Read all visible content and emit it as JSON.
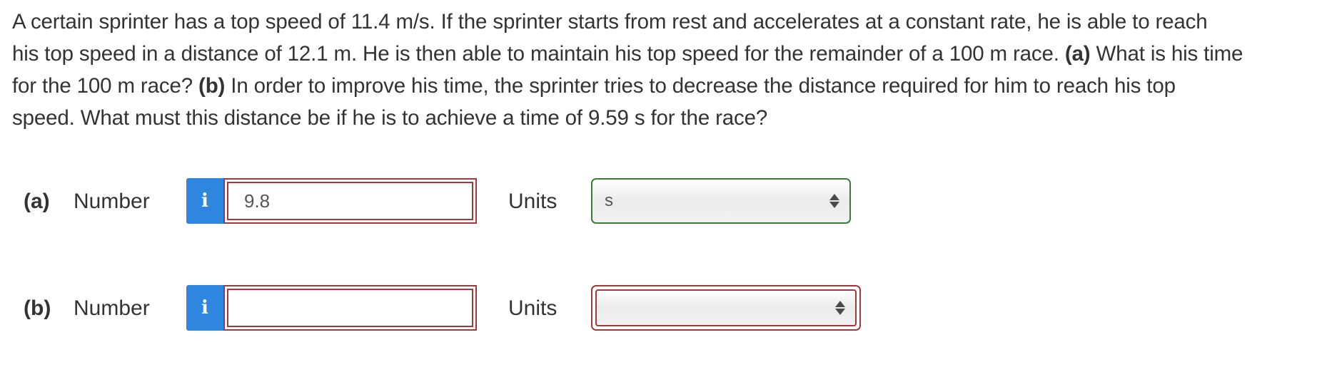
{
  "question": {
    "line1": "A certain sprinter has a top speed of 11.4 m/s. If the sprinter starts from rest and accelerates at a constant rate, he is able to reach",
    "line2_pre": "his top speed in a distance of 12.1 m. He is then able to maintain his top speed for the remainder of a 100 m race.",
    "part_a_tag": "(a)",
    "line2_post": "What is his time",
    "line3_pre": "for the 100 m race?",
    "part_b_tag": "(b)",
    "line3_post": "In order to improve his time, the sprinter tries to decrease the distance required for him to reach his top",
    "line4": "speed. What must this distance be if he is to achieve a time of 9.59 s for the race?"
  },
  "parts": {
    "a": {
      "label": "(a)",
      "number_label": "Number",
      "info_glyph": "i",
      "number_value": "9.8",
      "number_status": "incorrect",
      "units_label": "Units",
      "units_value": "s",
      "units_status": "correct"
    },
    "b": {
      "label": "(b)",
      "number_label": "Number",
      "info_glyph": "i",
      "number_value": "",
      "number_status": "incorrect",
      "units_label": "Units",
      "units_value": "",
      "units_status": "incorrect"
    }
  },
  "colors": {
    "info_button": "#2f86de",
    "incorrect_border": "#9e3a3a",
    "correct_border": "#3c7a3c",
    "text": "#333333"
  },
  "icons": {
    "info": "info-icon",
    "select_arrows": "up-down-arrows-icon"
  }
}
